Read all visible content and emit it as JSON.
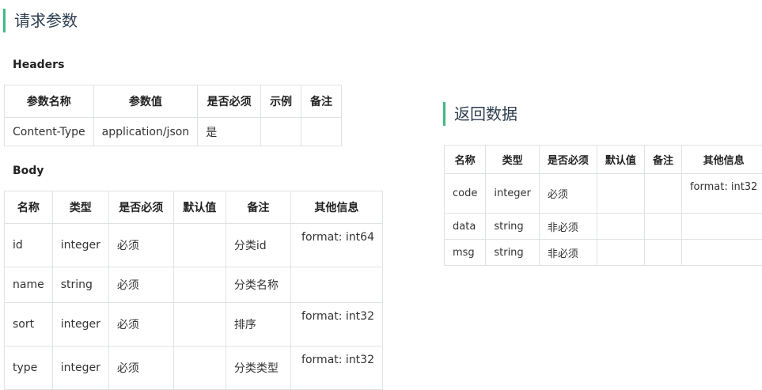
{
  "request": {
    "title": "请求参数",
    "headers_label": "Headers",
    "headers_table": {
      "columns": [
        "参数名称",
        "参数值",
        "是否必须",
        "示例",
        "备注"
      ],
      "rows": [
        [
          "Content-Type",
          "application/json",
          "是",
          "",
          ""
        ]
      ]
    },
    "body_label": "Body",
    "body_table": {
      "columns": [
        "名称",
        "类型",
        "是否必须",
        "默认值",
        "备注",
        "其他信息"
      ],
      "rows": [
        [
          "id",
          "integer",
          "必须",
          "",
          "分类id",
          "format: int64"
        ],
        [
          "name",
          "string",
          "必须",
          "",
          "分类名称",
          ""
        ],
        [
          "sort",
          "integer",
          "必须",
          "",
          "排序",
          "format: int32"
        ],
        [
          "type",
          "integer",
          "必须",
          "",
          "分类类型",
          "format: int32"
        ]
      ]
    }
  },
  "response": {
    "title": "返回数据",
    "table": {
      "columns": [
        "名称",
        "类型",
        "是否必须",
        "默认值",
        "备注",
        "其他信息"
      ],
      "rows": [
        [
          "code",
          "integer",
          "必须",
          "",
          "",
          "format: int32"
        ],
        [
          "data",
          "string",
          "非必须",
          "",
          "",
          ""
        ],
        [
          "msg",
          "string",
          "非必须",
          "",
          "",
          ""
        ]
      ]
    }
  },
  "colors": {
    "accent": "#42b983",
    "border": "#dfe2e5"
  }
}
